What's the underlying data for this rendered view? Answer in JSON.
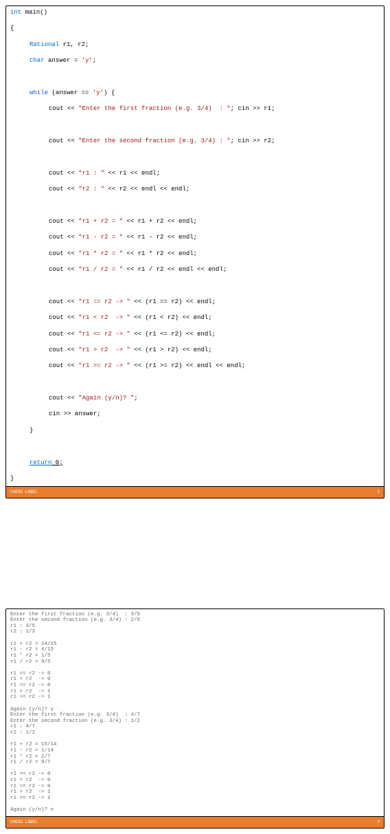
{
  "footer": {
    "label_left": "CHEGG LABEL",
    "page1": "2",
    "page2": "3"
  },
  "code": {
    "l1a": "int",
    "l1b": " main()",
    "l2": "{",
    "l3a": "Rational",
    "l3b": " r1, r2;",
    "l4a": "char",
    "l4b": " answer = ",
    "l4c": "'y'",
    "l4d": ";",
    "l5a": "while",
    "l5b": " (answer == ",
    "l5c": "'y'",
    "l5d": ") {",
    "l6a": "cout << ",
    "l6b": "\"Enter the first fraction (e.g. 3/4)  : \"",
    "l6c": "; cin >> r1;",
    "l7a": "cout << ",
    "l7b": "\"Enter the second fraction (e.g. 3/4) : \"",
    "l7c": "; cin >> r2;",
    "l8a": "cout << ",
    "l8b": "\"r1 : \"",
    "l8c": " << r1 << endl;",
    "l9a": "cout << ",
    "l9b": "\"r2 : \"",
    "l9c": " << r2 << endl << endl;",
    "l10a": "cout << ",
    "l10b": "\"r1 + r2 = \"",
    "l10c": " << r1 + r2 << endl;",
    "l11a": "cout << ",
    "l11b": "\"r1 - r2 = \"",
    "l11c": " << r1 - r2 << endl;",
    "l12a": "cout << ",
    "l12b": "\"r1 * r2 = \"",
    "l12c": " << r1 * r2 << endl;",
    "l13a": "cout << ",
    "l13b": "\"r1 / r2 = \"",
    "l13c": " << r1 / r2 << endl << endl;",
    "l14a": "cout << ",
    "l14b": "\"r1 == r2 -> \"",
    "l14c": " << (r1 == r2) << endl;",
    "l15a": "cout << ",
    "l15b": "\"r1 < r2  -> \"",
    "l15c": " << (r1 < r2) << endl;",
    "l16a": "cout << ",
    "l16b": "\"r1 <= r2 -> \"",
    "l16c": " << (r1 <= r2) << endl;",
    "l17a": "cout << ",
    "l17b": "\"r1 > r2  -> \"",
    "l17c": " << (r1 > r2) << endl;",
    "l18a": "cout << ",
    "l18b": "\"r1 >= r2 -> \"",
    "l18c": " << (r1 >= r2) << endl << endl;",
    "l19a": "cout << ",
    "l19b": "\"Again (y/n)? \"",
    "l19c": ";",
    "l20": "cin >> answer;",
    "l21": "}",
    "l22a": "return",
    "l22b": " 0;",
    "l23": "}"
  },
  "output": "Enter the first fraction (e.g. 3/4)  : 3/5\nEnter the second fraction (e.g. 3/4) : 2/6\nr1 : 3/5\nr2 : 1/3\n\nr1 + r2 = 14/15\nr1 - r2 = 4/15\nr1 * r2 = 1/5\nr1 / r2 = 9/5\n\nr1 == r2 -> 0\nr1 < r2  -> 0\nr1 <= r2 -> 0\nr1 > r2  -> 1\nr1 >= r2 -> 1\n\nAgain (y/n)? y\nEnter the first fraction (e.g. 3/4)  : 4/7\nEnter the second fraction (e.g. 3/4) : 1/2\nr1 : 4/7\nr2 : 1/2\n\nr1 + r2 = 15/14\nr1 - r2 = 1/14\nr1 * r2 = 2/7\nr1 / r2 = 8/7\n\nr1 == r2 -> 0\nr1 < r2  -> 0\nr1 <= r2 -> 0\nr1 > r2  -> 1\nr1 >= r2 -> 1\n\nAgain (y/n)? n"
}
